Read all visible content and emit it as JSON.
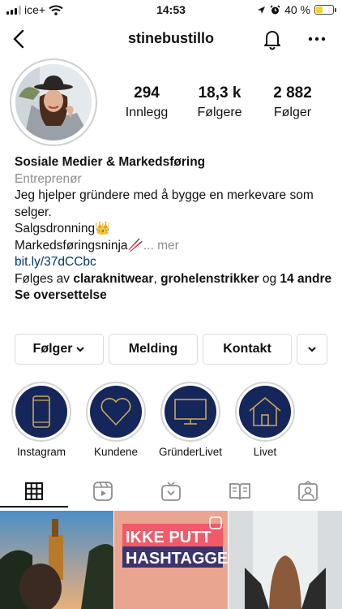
{
  "status_bar": {
    "carrier": "ice+",
    "time": "14:53",
    "battery_percent": "40 %",
    "battery_level": 0.4
  },
  "nav": {
    "username": "stinebustillo",
    "icons": [
      "back-chevron-icon",
      "bell-icon",
      "more-icon"
    ]
  },
  "stats": [
    {
      "value": "294",
      "label": "Innlegg"
    },
    {
      "value": "18,3 k",
      "label": "Følgere"
    },
    {
      "value": "2 882",
      "label": "Følger"
    }
  ],
  "bio": {
    "name": "Sosiale Medier & Markedsføring",
    "category": "Entreprenør",
    "line1": "Jeg hjelper gründere med å bygge en merkevare som selger.",
    "line2": "Salgsdronning👑",
    "line3": "Markedsføringsninja🥢",
    "more": "... mer",
    "link": "bit.ly/37dCCbc",
    "followed_prefix": "Følges av ",
    "followed_user1": "claraknitwear",
    "followed_sep": ", ",
    "followed_user2": "grohelenstrikker",
    "followed_and": " og ",
    "followed_others": "14 andre",
    "translate": "Se oversettelse"
  },
  "buttons": {
    "following": "Følger",
    "message": "Melding",
    "contact": "Kontakt"
  },
  "highlights": [
    {
      "label": "Instagram",
      "icon": "phone-icon"
    },
    {
      "label": "Kundene",
      "icon": "heart-icon"
    },
    {
      "label": "GründerLivet",
      "icon": "monitor-icon"
    },
    {
      "label": "Livet",
      "icon": "house-icon"
    }
  ],
  "tabs": [
    "grid-icon",
    "reels-icon",
    "igtv-icon",
    "guides-icon",
    "tagged-icon"
  ],
  "grid_posts": [
    {
      "text": ""
    },
    {
      "text_line1": "IKKE PUTT",
      "text_line2": "HASHTAGGER"
    },
    {
      "text": ""
    }
  ],
  "colors": {
    "highlight_bg": "#14265a",
    "highlight_gold": "#c9a65a",
    "link": "#00376b",
    "battery": "#f2d22e"
  }
}
